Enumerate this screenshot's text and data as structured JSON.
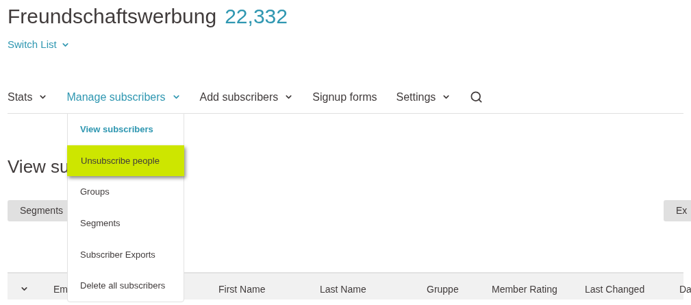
{
  "header": {
    "title": "Freundschaftswerbung",
    "count": "22,332",
    "switch_list": "Switch List"
  },
  "nav": [
    {
      "label": "Stats",
      "selected": false,
      "kind": "dropdown"
    },
    {
      "label": "Manage subscribers",
      "selected": true,
      "kind": "dropdown"
    },
    {
      "label": "Add subscribers",
      "selected": false,
      "kind": "dropdown"
    },
    {
      "label": "Signup forms",
      "selected": false,
      "kind": "link"
    },
    {
      "label": "Settings",
      "selected": false,
      "kind": "dropdown"
    },
    {
      "kind": "search"
    }
  ],
  "menu": [
    {
      "label": "View subscribers",
      "selected": true,
      "hovered": false
    },
    {
      "label": "Unsubscribe people",
      "selected": false,
      "hovered": true
    },
    {
      "label": "Groups",
      "selected": false,
      "hovered": false
    },
    {
      "label": "Segments",
      "selected": false,
      "hovered": false
    },
    {
      "label": "Subscriber Exports",
      "selected": false,
      "hovered": false
    },
    {
      "label": "Delete all subscribers",
      "selected": false,
      "hovered": false
    }
  ],
  "page_heading": "View su",
  "segments_button": "Segments",
  "export_button": "Ex",
  "table": {
    "columns": [
      "Em",
      "First Name",
      "Last Name",
      "Gruppe",
      "Member Rating",
      "Last Changed",
      "Da"
    ]
  }
}
